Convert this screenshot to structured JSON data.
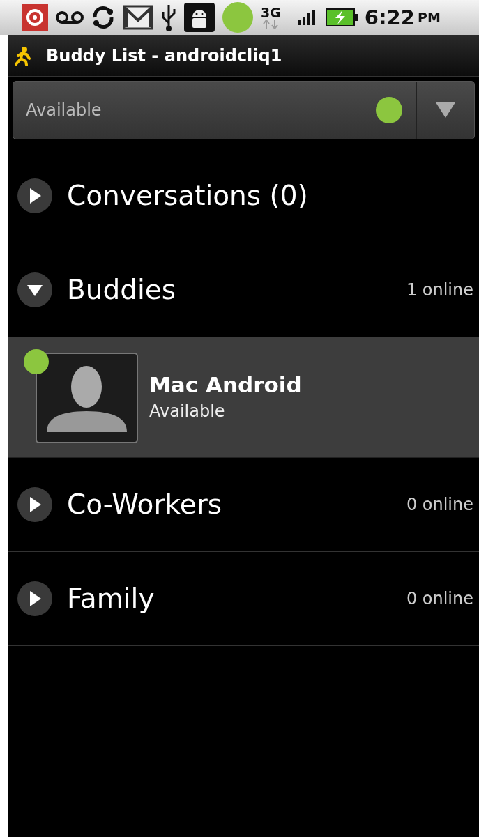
{
  "status_bar": {
    "network": "3G",
    "time": "6:22",
    "ampm": "PM"
  },
  "title_bar": {
    "title": "Buddy List - androidcliq1"
  },
  "presence": {
    "value": "Available"
  },
  "groups": [
    {
      "name": "Conversations (0)",
      "expanded": false
    },
    {
      "name": "Buddies",
      "expanded": true,
      "count": "1 online",
      "buddies": [
        {
          "name": "Mac Android",
          "status": "Available"
        }
      ]
    },
    {
      "name": "Co-Workers",
      "expanded": false,
      "count": "0 online"
    },
    {
      "name": "Family",
      "expanded": false,
      "count": "0 online"
    }
  ]
}
